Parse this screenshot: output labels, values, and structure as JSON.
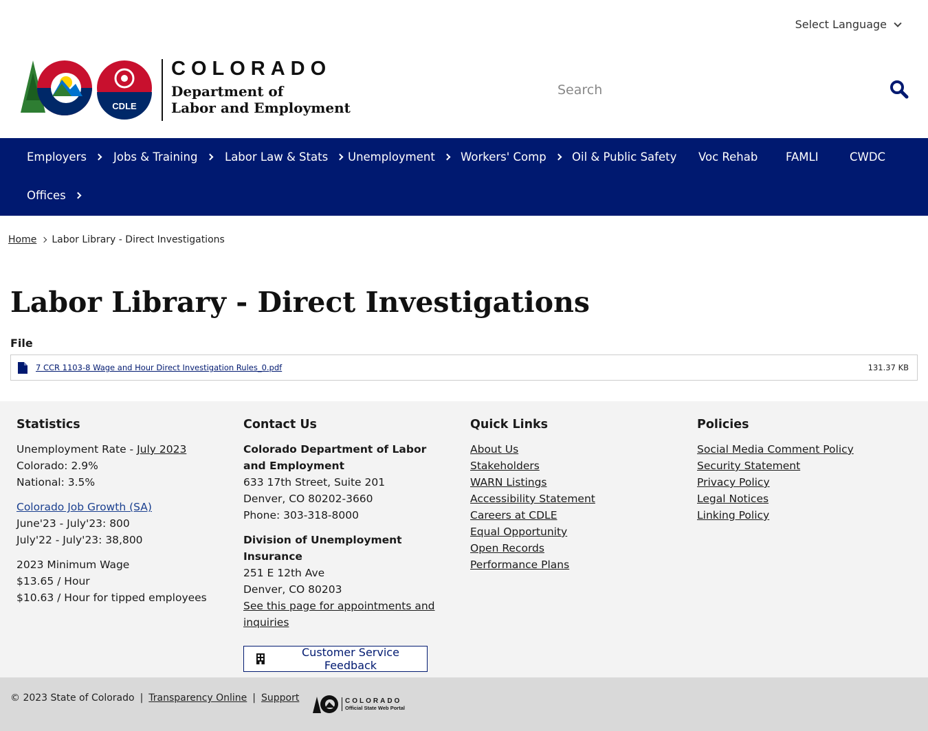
{
  "language": {
    "label": "Select Language"
  },
  "logo": {
    "badge": "CDLE",
    "state": "COLORADO",
    "dept_line1": "Department of",
    "dept_line2": "Labor and Employment"
  },
  "search": {
    "placeholder": "Search"
  },
  "nav": {
    "items": [
      {
        "label": "Employers"
      },
      {
        "label": "Jobs & Training"
      },
      {
        "label": "Labor Law & Stats"
      },
      {
        "label": "Unemployment"
      },
      {
        "label": "Workers' Comp"
      },
      {
        "label": "Oil & Public Safety"
      },
      {
        "label": "Voc Rehab"
      },
      {
        "label": "FAMLI"
      },
      {
        "label": "CWDC"
      },
      {
        "label": "Offices"
      }
    ]
  },
  "breadcrumb": {
    "home": "Home",
    "current": "Labor Library - Direct Investigations"
  },
  "page": {
    "title": "Labor Library - Direct Investigations",
    "file_label": "File"
  },
  "file": {
    "name": "7 CCR 1103-8 Wage and Hour Direct Investigation Rules_0.pdf",
    "size": "131.37 KB"
  },
  "footer": {
    "statistics": {
      "heading": "Statistics",
      "unemp_prefix": "Unemployment Rate - ",
      "unemp_link": "July 2023",
      "colorado": "Colorado: 2.9%",
      "national": "National: 3.5%",
      "job_growth_link": "Colorado Job Growth (SA)",
      "june_july": "June'23 - July'23: 800",
      "yoy": "July'22 - July'23: 38,800",
      "min_wage_title": "2023 Minimum Wage",
      "min_wage": "$13.65 / Hour",
      "tipped": "$10.63 / Hour for tipped employees"
    },
    "contact": {
      "heading": "Contact Us",
      "org": "Colorado Department of Labor and Employment",
      "addr1": "633 17th Street, Suite 201",
      "addr2": "Denver, CO  80202-3660",
      "phone": "Phone: 303-318-8000",
      "div": "Division of Unemployment Insurance",
      "div_addr1": "251 E 12th Ave",
      "div_addr2": "Denver, CO  80203",
      "appt_link": "See this page for appointments and inquiries",
      "feedback": "Customer Service Feedback"
    },
    "quick_links": {
      "heading": "Quick Links",
      "links": [
        "About Us",
        "Stakeholders",
        "WARN Listings",
        "Accessibility Statement",
        "Careers at CDLE",
        "Equal Opportunity",
        "Open Records",
        "Performance Plans"
      ]
    },
    "policies": {
      "heading": "Policies",
      "links": [
        "Social Media Comment Policy",
        "Security Statement",
        "Privacy Policy",
        "Legal Notices",
        "Linking Policy"
      ]
    }
  },
  "bottom": {
    "copyright": "© 2023 State of Colorado",
    "sep": "|",
    "transparency": "Transparency Online",
    "support": "Support",
    "portal_state": "COLORADO",
    "portal_sub": "Official State Web Portal"
  },
  "colors": {
    "nav_bg": "#001970",
    "link_blue": "#1a3f8f",
    "footer_bg": "#f3f3f3",
    "bottom_bg": "#d9d9d9"
  }
}
